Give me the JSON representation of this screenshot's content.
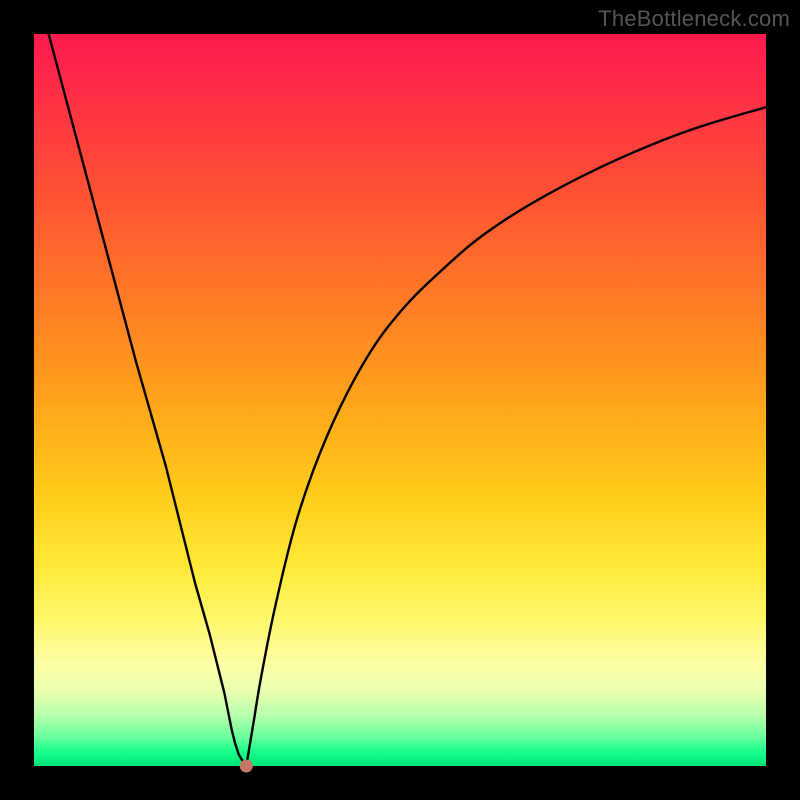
{
  "watermark": "TheBottleneck.com",
  "chart_data": {
    "type": "line",
    "title": "",
    "xlabel": "",
    "ylabel": "",
    "xlim": [
      0,
      100
    ],
    "ylim": [
      0,
      100
    ],
    "series": [
      {
        "name": "left-branch",
        "x": [
          2,
          6,
          10,
          14,
          18,
          22,
          24,
          26,
          27,
          27.5,
          28,
          28.5,
          29
        ],
        "y": [
          100,
          85,
          70,
          55,
          41,
          25,
          18,
          10,
          5,
          3,
          1.5,
          0.7,
          0
        ]
      },
      {
        "name": "right-branch",
        "x": [
          29,
          30,
          31,
          33,
          36,
          40,
          45,
          50,
          56,
          62,
          70,
          80,
          90,
          100
        ],
        "y": [
          0,
          6,
          12,
          22,
          34,
          45,
          55,
          62,
          68,
          73,
          78,
          83,
          87,
          90
        ]
      }
    ],
    "marker": {
      "x": 29,
      "y": 0,
      "color": "#c9766a"
    },
    "background_gradient": {
      "top": "#ff1a4d",
      "mid": "#ffc91a",
      "bottom": "#00e676"
    }
  }
}
